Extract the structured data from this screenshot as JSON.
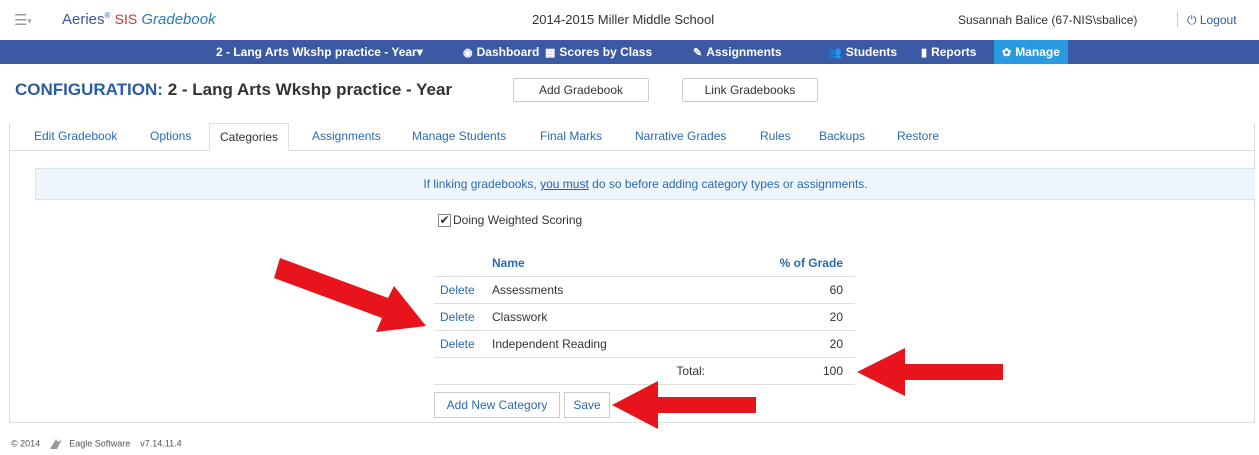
{
  "header": {
    "menu_icon": "hamburger-icon",
    "brand_main": "Aeries",
    "brand_reg": "®",
    "brand_sis": "SIS",
    "brand_gradebook": "Gradebook",
    "school": "2014-2015 Miller Middle School",
    "user": "Susannah Balice (67-NIS\\sbalice)",
    "logout": "Logout"
  },
  "nav": {
    "gradebook_select": "2 - Lang Arts Wkshp practice - Year",
    "dashboard": "Dashboard",
    "scores_by_class": "Scores by Class",
    "assignments": "Assignments",
    "students": "Students",
    "reports": "Reports",
    "manage": "Manage"
  },
  "page": {
    "title_label": "CONFIGURATION:",
    "title_value": "2 - Lang Arts Wkshp practice - Year",
    "add_gradebook": "Add Gradebook",
    "link_gradebooks": "Link Gradebooks"
  },
  "tabs": [
    {
      "label": "Edit Gradebook"
    },
    {
      "label": "Options"
    },
    {
      "label": "Categories"
    },
    {
      "label": "Assignments"
    },
    {
      "label": "Manage Students"
    },
    {
      "label": "Final Marks"
    },
    {
      "label": "Narrative Grades"
    },
    {
      "label": "Rules"
    },
    {
      "label": "Backups"
    },
    {
      "label": "Restore"
    }
  ],
  "info": {
    "pre": "If linking gradebooks,",
    "link": "you must",
    "post": "do so before adding category types or assignments."
  },
  "weighted": {
    "checked": true,
    "label": "Doing Weighted Scoring"
  },
  "table": {
    "headers": {
      "name": "Name",
      "pct": "% of Grade"
    },
    "delete_label": "Delete",
    "rows": [
      {
        "name": "Assessments",
        "pct": "60"
      },
      {
        "name": "Classwork",
        "pct": "20"
      },
      {
        "name": "Independent Reading",
        "pct": "20"
      }
    ],
    "total_label": "Total:",
    "total_value": "100"
  },
  "actions": {
    "add_category": "Add New Category",
    "save": "Save"
  },
  "footer": {
    "copyright": "© 2014",
    "company": "Eagle Software",
    "version": "v7.14.11.4"
  },
  "colors": {
    "nav_bg": "#3b5aa3",
    "nav_active": "#2a9be0",
    "link": "#2a6bb0",
    "arrow": "#e8141b"
  }
}
